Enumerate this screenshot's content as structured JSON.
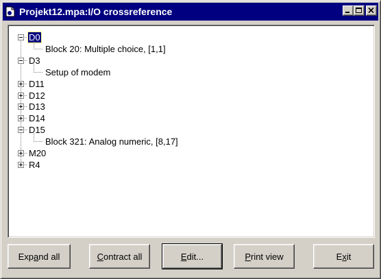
{
  "window": {
    "title": "Projekt12.mpa:I/O crossreference",
    "icon": "document-app-icon",
    "caption_buttons": [
      "minimize-icon",
      "maximize-icon",
      "close-icon"
    ]
  },
  "tree": {
    "nodes": [
      {
        "label": "D0",
        "expanded": true,
        "selected": true,
        "children": [
          "Block 20: Multiple choice, [1,1]"
        ]
      },
      {
        "label": "D3",
        "expanded": true,
        "children": [
          "Setup of modem"
        ]
      },
      {
        "label": "D11",
        "expanded": false
      },
      {
        "label": "D12",
        "expanded": false
      },
      {
        "label": "D13",
        "expanded": false
      },
      {
        "label": "D14",
        "expanded": false
      },
      {
        "label": "D15",
        "expanded": true,
        "children": [
          "Block 321: Analog numeric, [8,17]"
        ]
      },
      {
        "label": "M20",
        "expanded": false
      },
      {
        "label": "R4",
        "expanded": false
      }
    ]
  },
  "buttons": {
    "expand_all": {
      "pre": "Exp",
      "key": "a",
      "post": "nd all"
    },
    "contract_all": {
      "pre": "",
      "key": "C",
      "post": "ontract all"
    },
    "edit": {
      "pre": "",
      "key": "E",
      "post": "dit..."
    },
    "print_view": {
      "pre": "",
      "key": "P",
      "post": "rint view"
    },
    "exit": {
      "pre": "E",
      "key": "x",
      "post": "it"
    }
  },
  "colors": {
    "titlebar": "#000080",
    "selection": "#000080",
    "face": "#d4d0c8"
  }
}
